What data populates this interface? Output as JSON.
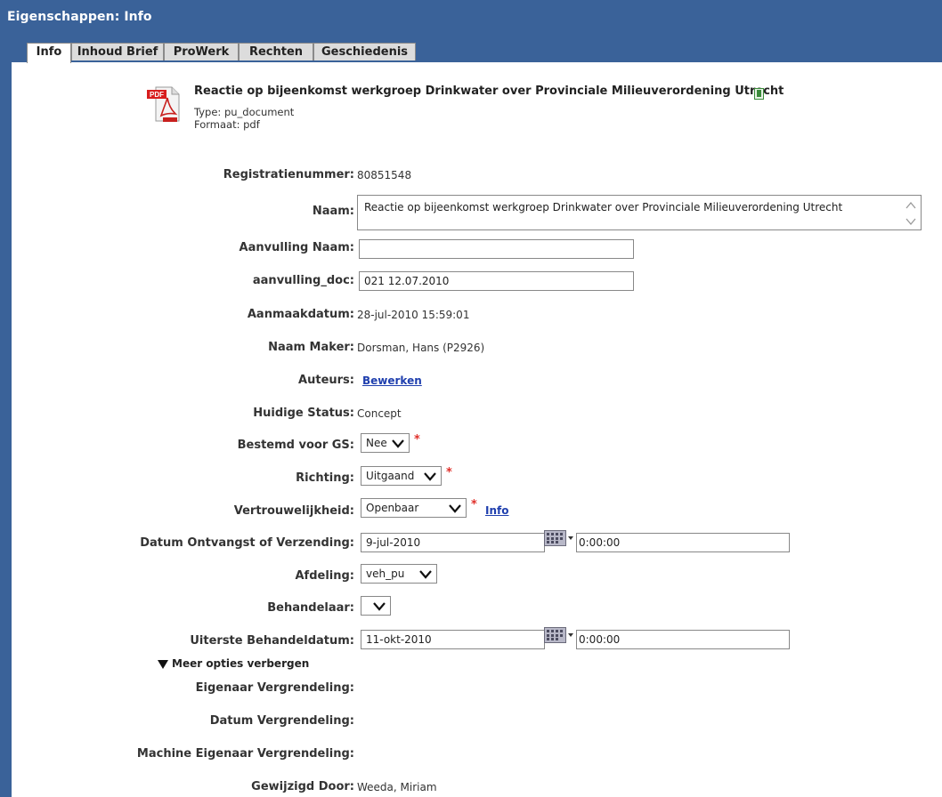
{
  "window": {
    "title": "Eigenschappen: Info"
  },
  "tabs": [
    {
      "label": "Info"
    },
    {
      "label": "Inhoud Brief"
    },
    {
      "label": "ProWerk"
    },
    {
      "label": "Rechten"
    },
    {
      "label": "Geschiedenis"
    }
  ],
  "document": {
    "title": "Reactie op bijeenkomst werkgroep Drinkwater over Provinciale Milieuverordening Utrecht",
    "type_line": "Type:  pu_document",
    "format_line": "Formaat:  pdf",
    "icon": "pdf-icon"
  },
  "fields": {
    "registratienummer": {
      "label": "Registratienummer:",
      "value": "80851548"
    },
    "naam": {
      "label": "Naam:",
      "value": "Reactie op bijeenkomst werkgroep Drinkwater over Provinciale Milieuverordening Utrecht"
    },
    "aanvulling_naam": {
      "label": "Aanvulling Naam:",
      "value": ""
    },
    "aanvulling_doc": {
      "label": "aanvulling_doc:",
      "value": "021 12.07.2010"
    },
    "aanmaakdatum": {
      "label": "Aanmaakdatum:",
      "value": "28-jul-2010 15:59:01"
    },
    "naam_maker": {
      "label": "Naam Maker:",
      "value": "Dorsman, Hans (P2926)"
    },
    "auteurs": {
      "label": "Auteurs:",
      "link": "Bewerken"
    },
    "huidige_status": {
      "label": "Huidige Status:",
      "value": "Concept"
    },
    "bestemd_voor_gs": {
      "label": "Bestemd voor GS:",
      "value": "Nee",
      "required": "*"
    },
    "richting": {
      "label": "Richting:",
      "value": "Uitgaand",
      "required": "*"
    },
    "vertrouwelijkheid": {
      "label": "Vertrouwelijkheid:",
      "value": "Openbaar",
      "required": "*",
      "link": "Info"
    },
    "datum_ontvangst": {
      "label": "Datum Ontvangst of Verzending:",
      "date": "9-jul-2010",
      "time": "0:00:00"
    },
    "afdeling": {
      "label": "Afdeling:",
      "value": "veh_pu"
    },
    "behandelaar": {
      "label": "Behandelaar:",
      "value": ""
    },
    "uiterste_behandeldatum": {
      "label": "Uiterste Behandeldatum:",
      "date": "11-okt-2010",
      "time": "0:00:00"
    },
    "meer_opties": {
      "label": "Meer opties verbergen"
    },
    "eigenaar_vergrendeling": {
      "label": "Eigenaar Vergrendeling:"
    },
    "datum_vergrendeling": {
      "label": "Datum Vergrendeling:"
    },
    "machine_eigenaar_vergrendeling": {
      "label": "Machine Eigenaar Vergrendeling:"
    },
    "gewijzigd_door": {
      "label": "Gewijzigd Door:",
      "value": "Weeda, Miriam"
    }
  },
  "colors": {
    "titlebar": "#3a6299",
    "link": "#1f3fae",
    "required": "#e0302a"
  }
}
